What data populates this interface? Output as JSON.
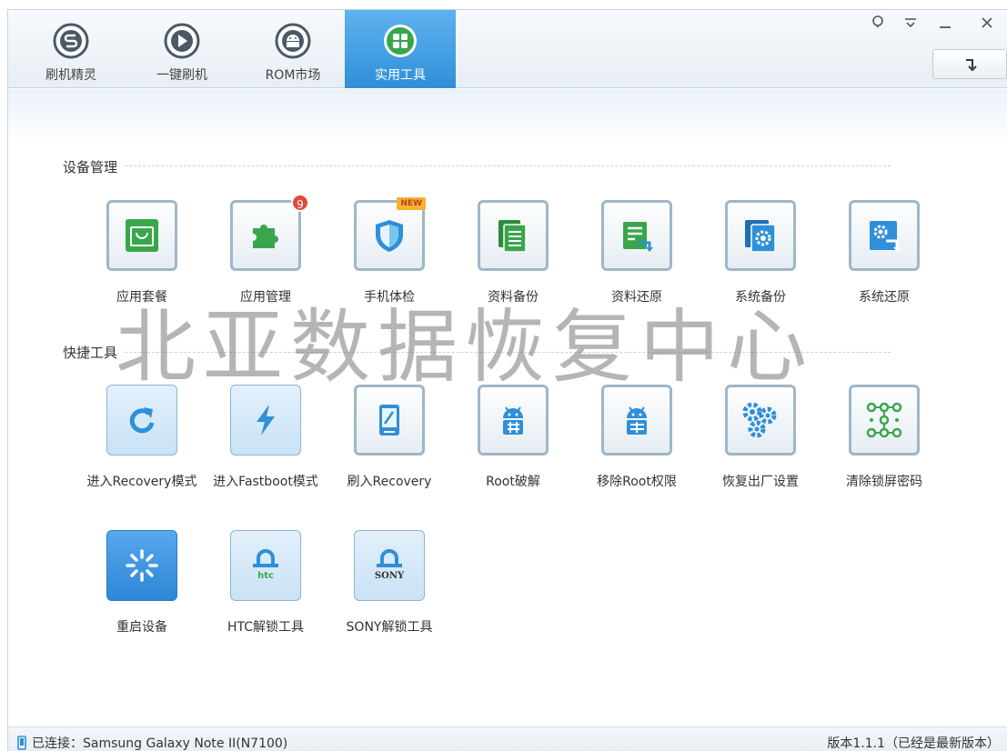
{
  "nav": {
    "tabs": [
      {
        "label": "刷机精灵",
        "icon": "s-logo-icon"
      },
      {
        "label": "一键刷机",
        "icon": "play-icon"
      },
      {
        "label": "ROM市场",
        "icon": "android-icon"
      },
      {
        "label": "实用工具",
        "icon": "grid-icon"
      }
    ],
    "active_tab": "实用工具"
  },
  "window_controls": [
    "feedback-icon",
    "menu-icon",
    "minimize-icon",
    "close-icon"
  ],
  "sections": {
    "device": {
      "title": "设备管理"
    },
    "quick": {
      "title": "快捷工具"
    }
  },
  "device_tools": [
    {
      "label": "应用套餐",
      "icon": "app-bag-icon"
    },
    {
      "label": "应用管理",
      "icon": "puzzle-icon",
      "badge": "9"
    },
    {
      "label": "手机体检",
      "icon": "shield-icon",
      "badge": "NEW"
    },
    {
      "label": "资料备份",
      "icon": "data-backup-icon"
    },
    {
      "label": "资料还原",
      "icon": "data-restore-icon"
    },
    {
      "label": "系统备份",
      "icon": "system-backup-icon"
    },
    {
      "label": "系统还原",
      "icon": "system-restore-icon"
    }
  ],
  "quick_tools": [
    {
      "label": "进入Recovery模式",
      "icon": "refresh-icon"
    },
    {
      "label": "进入Fastboot模式",
      "icon": "lightning-icon"
    },
    {
      "label": "刷入Recovery",
      "icon": "tablet-icon"
    },
    {
      "label": "Root破解",
      "icon": "android-root-icon"
    },
    {
      "label": "移除Root权限",
      "icon": "android-remove-icon"
    },
    {
      "label": "恢复出厂设置",
      "icon": "gears-icon"
    },
    {
      "label": "清除锁屏密码",
      "icon": "pattern-lock-icon"
    },
    {
      "label": "重启设备",
      "icon": "spinner-icon"
    },
    {
      "label": "HTC解锁工具",
      "icon": "htc-lock-icon"
    },
    {
      "label": "SONY解锁工具",
      "icon": "sony-lock-icon"
    }
  ],
  "watermark": "北亚数据恢复中心",
  "status": {
    "connection": "已连接：Samsung Galaxy Note II(N7100)",
    "version": "版本1.1.1（已经是最新版本）"
  },
  "colors": {
    "accent": "#2f8fd8",
    "green": "#3aa64c",
    "badge_red": "#e5473d"
  }
}
